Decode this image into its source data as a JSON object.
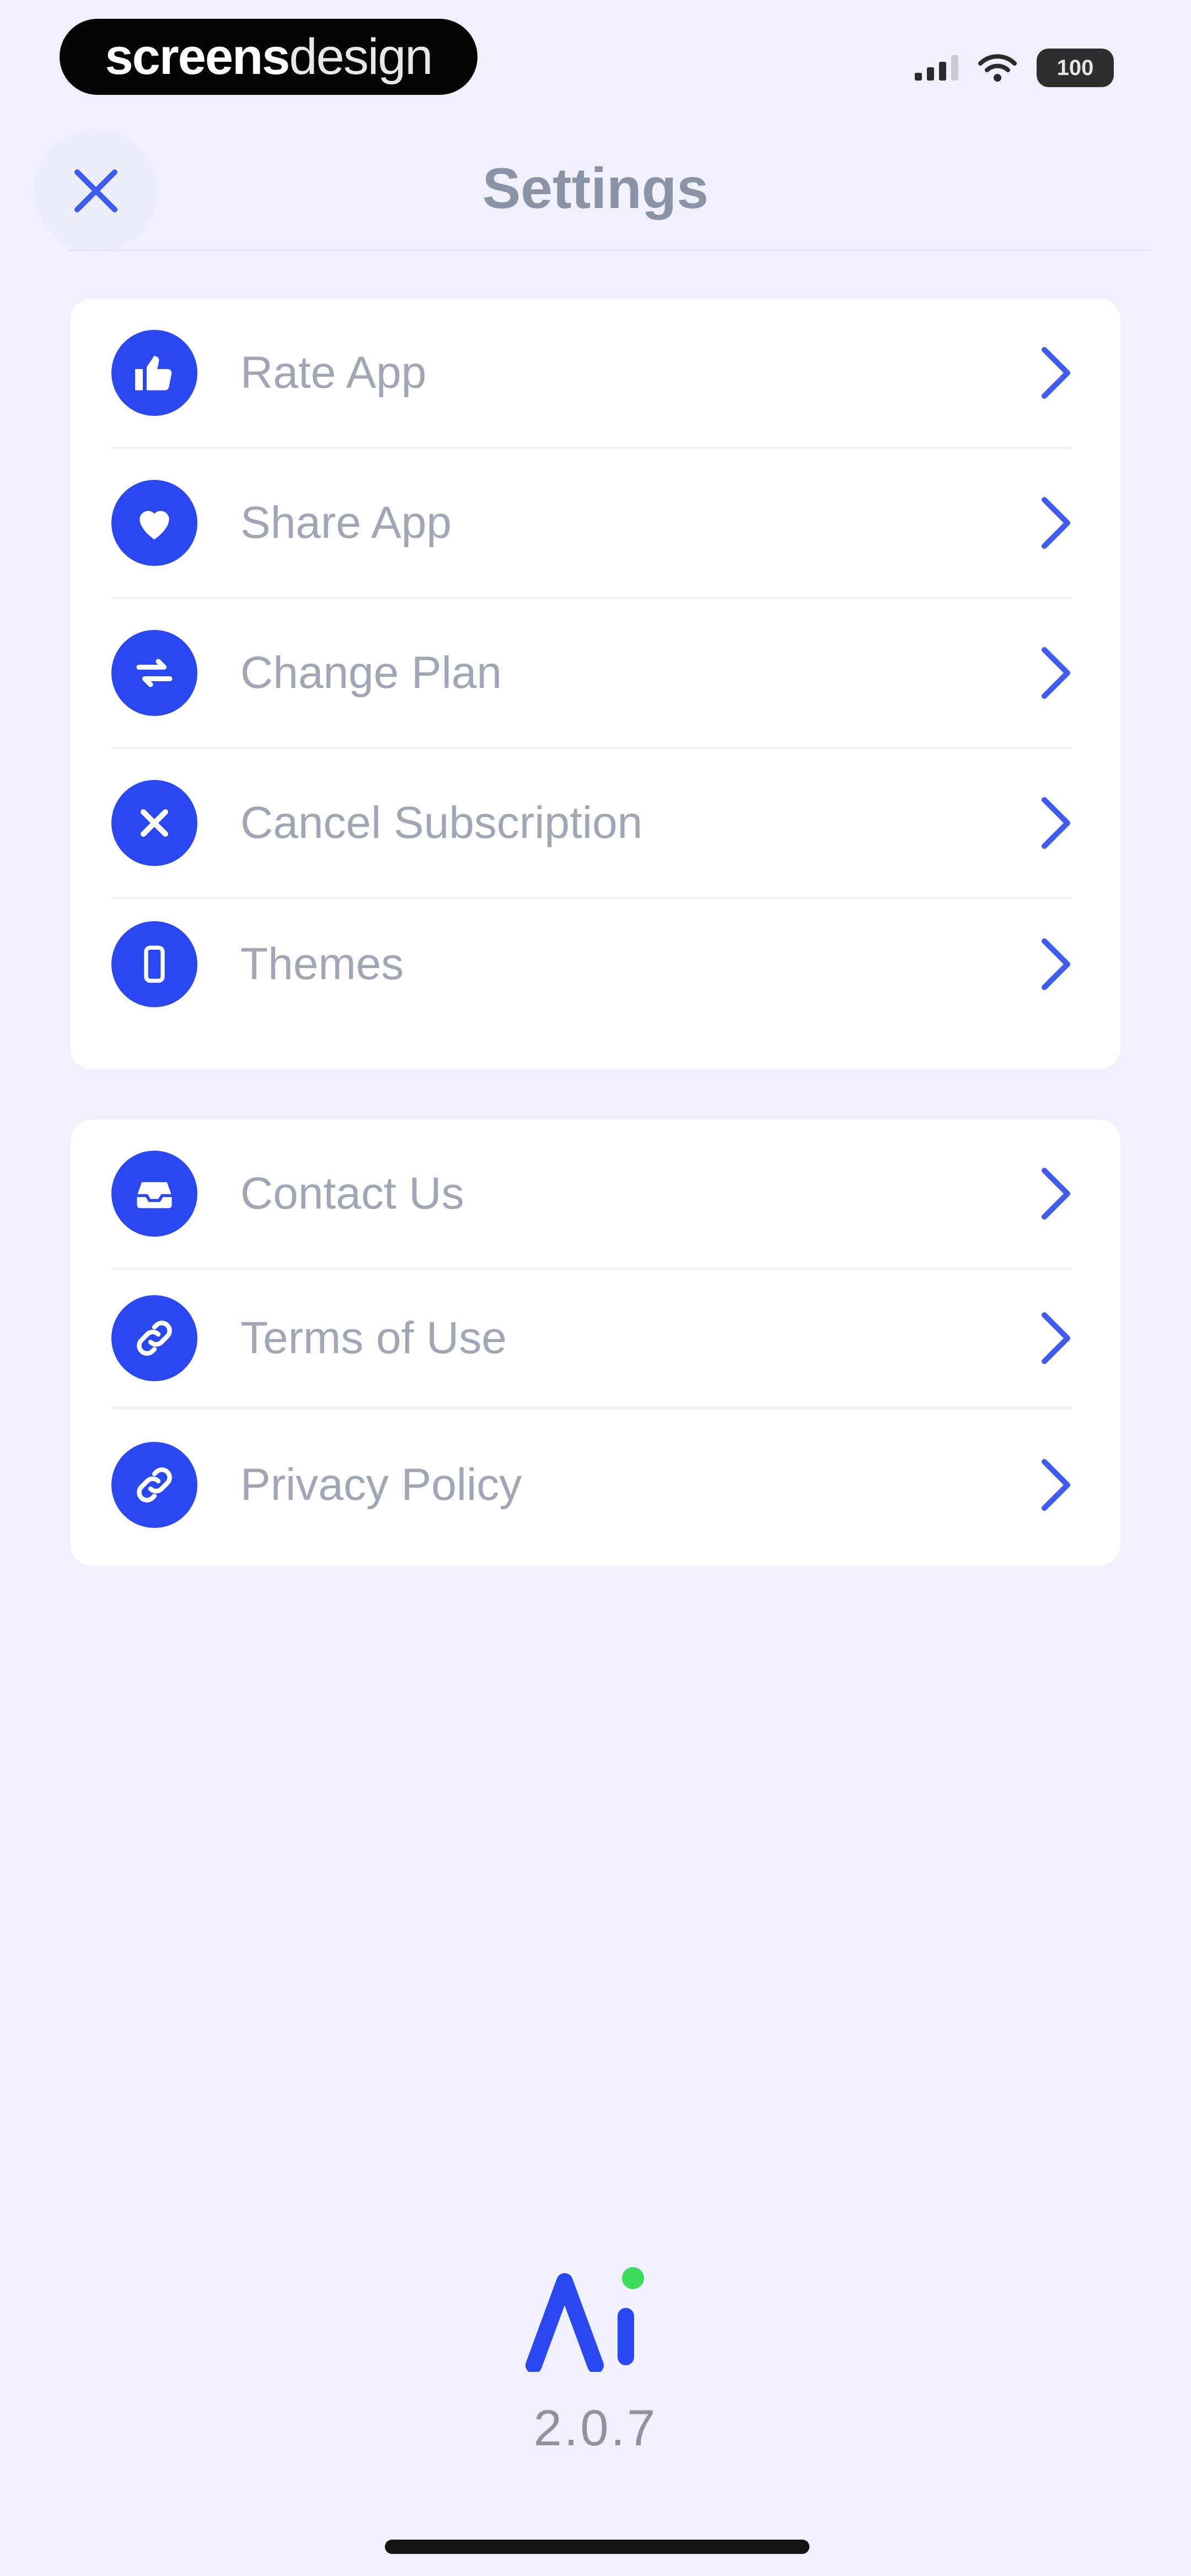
{
  "status_bar": {
    "brand_bold": "screens",
    "brand_light": "design",
    "battery": "100"
  },
  "header": {
    "title": "Settings",
    "close_icon": "close-icon"
  },
  "settings_group_1": [
    {
      "label": "Rate App",
      "icon": "thumbs-up-icon"
    },
    {
      "label": "Share App",
      "icon": "heart-icon"
    },
    {
      "label": "Change Plan",
      "icon": "swap-arrows-icon"
    },
    {
      "label": "Cancel Subscription",
      "icon": "x-icon"
    },
    {
      "label": "Themes",
      "icon": "phone-icon"
    }
  ],
  "settings_group_2": [
    {
      "label": "Contact Us",
      "icon": "inbox-icon"
    },
    {
      "label": "Terms of Use",
      "icon": "link-icon"
    },
    {
      "label": "Privacy Policy",
      "icon": "link-icon"
    }
  ],
  "footer": {
    "logo_text": "Λi",
    "version": "2.0.7"
  },
  "colors": {
    "accent": "#2a48f2",
    "background": "#f0f1fc",
    "logo_dot": "#3ddc5a"
  }
}
